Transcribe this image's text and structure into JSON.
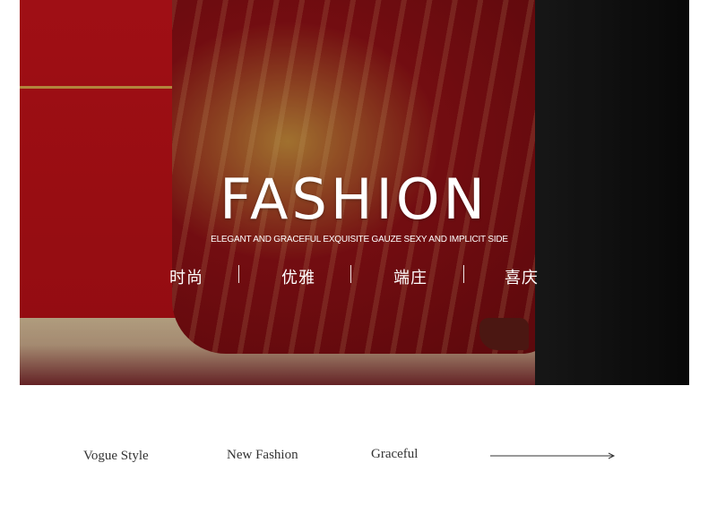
{
  "hero": {
    "title": "FASHION",
    "subtitle": "ELEGANT AND GRACEFUL EXQUISITE GAUZE SEXY AND IMPLICIT SIDE",
    "tags": [
      "时尚",
      "优雅",
      "端庄",
      "喜庆"
    ]
  },
  "bottom": {
    "words": [
      "Vogue Style",
      "New Fashion",
      "Graceful"
    ]
  }
}
